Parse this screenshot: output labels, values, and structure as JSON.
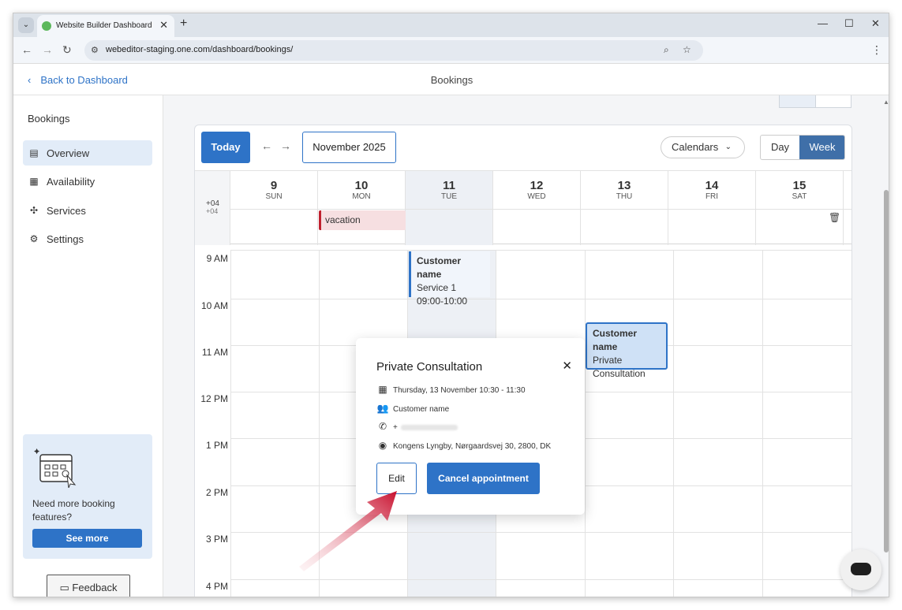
{
  "browser": {
    "tab_title": "Website Builder Dashboard",
    "url": "webeditor-staging.one.com/dashboard/bookings/",
    "tab_menu_icon": "chevron-down-icon",
    "new_tab_icon": "plus-icon",
    "window_controls": [
      "minimize-icon",
      "maximize-icon",
      "close-icon"
    ]
  },
  "header": {
    "back_label": "Back to Dashboard",
    "page_title": "Bookings"
  },
  "sidebar": {
    "title": "Bookings",
    "items": [
      {
        "label": "Overview",
        "icon": "layout-icon",
        "active": true
      },
      {
        "label": "Availability",
        "icon": "calendar-clock-icon",
        "active": false
      },
      {
        "label": "Services",
        "icon": "services-icon",
        "active": false
      },
      {
        "label": "Settings",
        "icon": "gear-icon",
        "active": false
      }
    ],
    "promo": {
      "text": "Need more booking features?",
      "button": "See more"
    },
    "feedback_label": "Feedback"
  },
  "calendar": {
    "today_label": "Today",
    "month_label": "November 2025",
    "calendars_label": "Calendars",
    "view_day": "Day",
    "view_week": "Week",
    "timezone": "+04",
    "timezone_sub": "+04",
    "days": [
      {
        "num": "9",
        "wd": "SUN"
      },
      {
        "num": "10",
        "wd": "MON"
      },
      {
        "num": "11",
        "wd": "TUE",
        "current": true
      },
      {
        "num": "12",
        "wd": "WED"
      },
      {
        "num": "13",
        "wd": "THU"
      },
      {
        "num": "14",
        "wd": "FRI"
      },
      {
        "num": "15",
        "wd": "SAT"
      }
    ],
    "allday_event": "vacation",
    "hours": [
      "9 AM",
      "10 AM",
      "11 AM",
      "12 PM",
      "1 PM",
      "2 PM",
      "3 PM",
      "4 PM"
    ],
    "events": [
      {
        "title": "Customer name",
        "line1": "Service 1",
        "line2": "09:00-10:00"
      },
      {
        "title": "Customer name",
        "line1": "Private",
        "line2": "Consultation"
      }
    ]
  },
  "popover": {
    "title": "Private Consultation",
    "date": "Thursday, 13 November 10:30 - 11:30",
    "customer": "Customer name",
    "phone_prefix": "+",
    "address": "Kongens Lyngby, Nørgaardsvej 30, 2800, DK",
    "edit_label": "Edit",
    "cancel_label": "Cancel appointment"
  },
  "colors": {
    "accent": "#2e73c7",
    "active_view": "#3f6fa8",
    "vacation_bar": "#c0212f",
    "annotation_arrow": "#c8102e"
  }
}
